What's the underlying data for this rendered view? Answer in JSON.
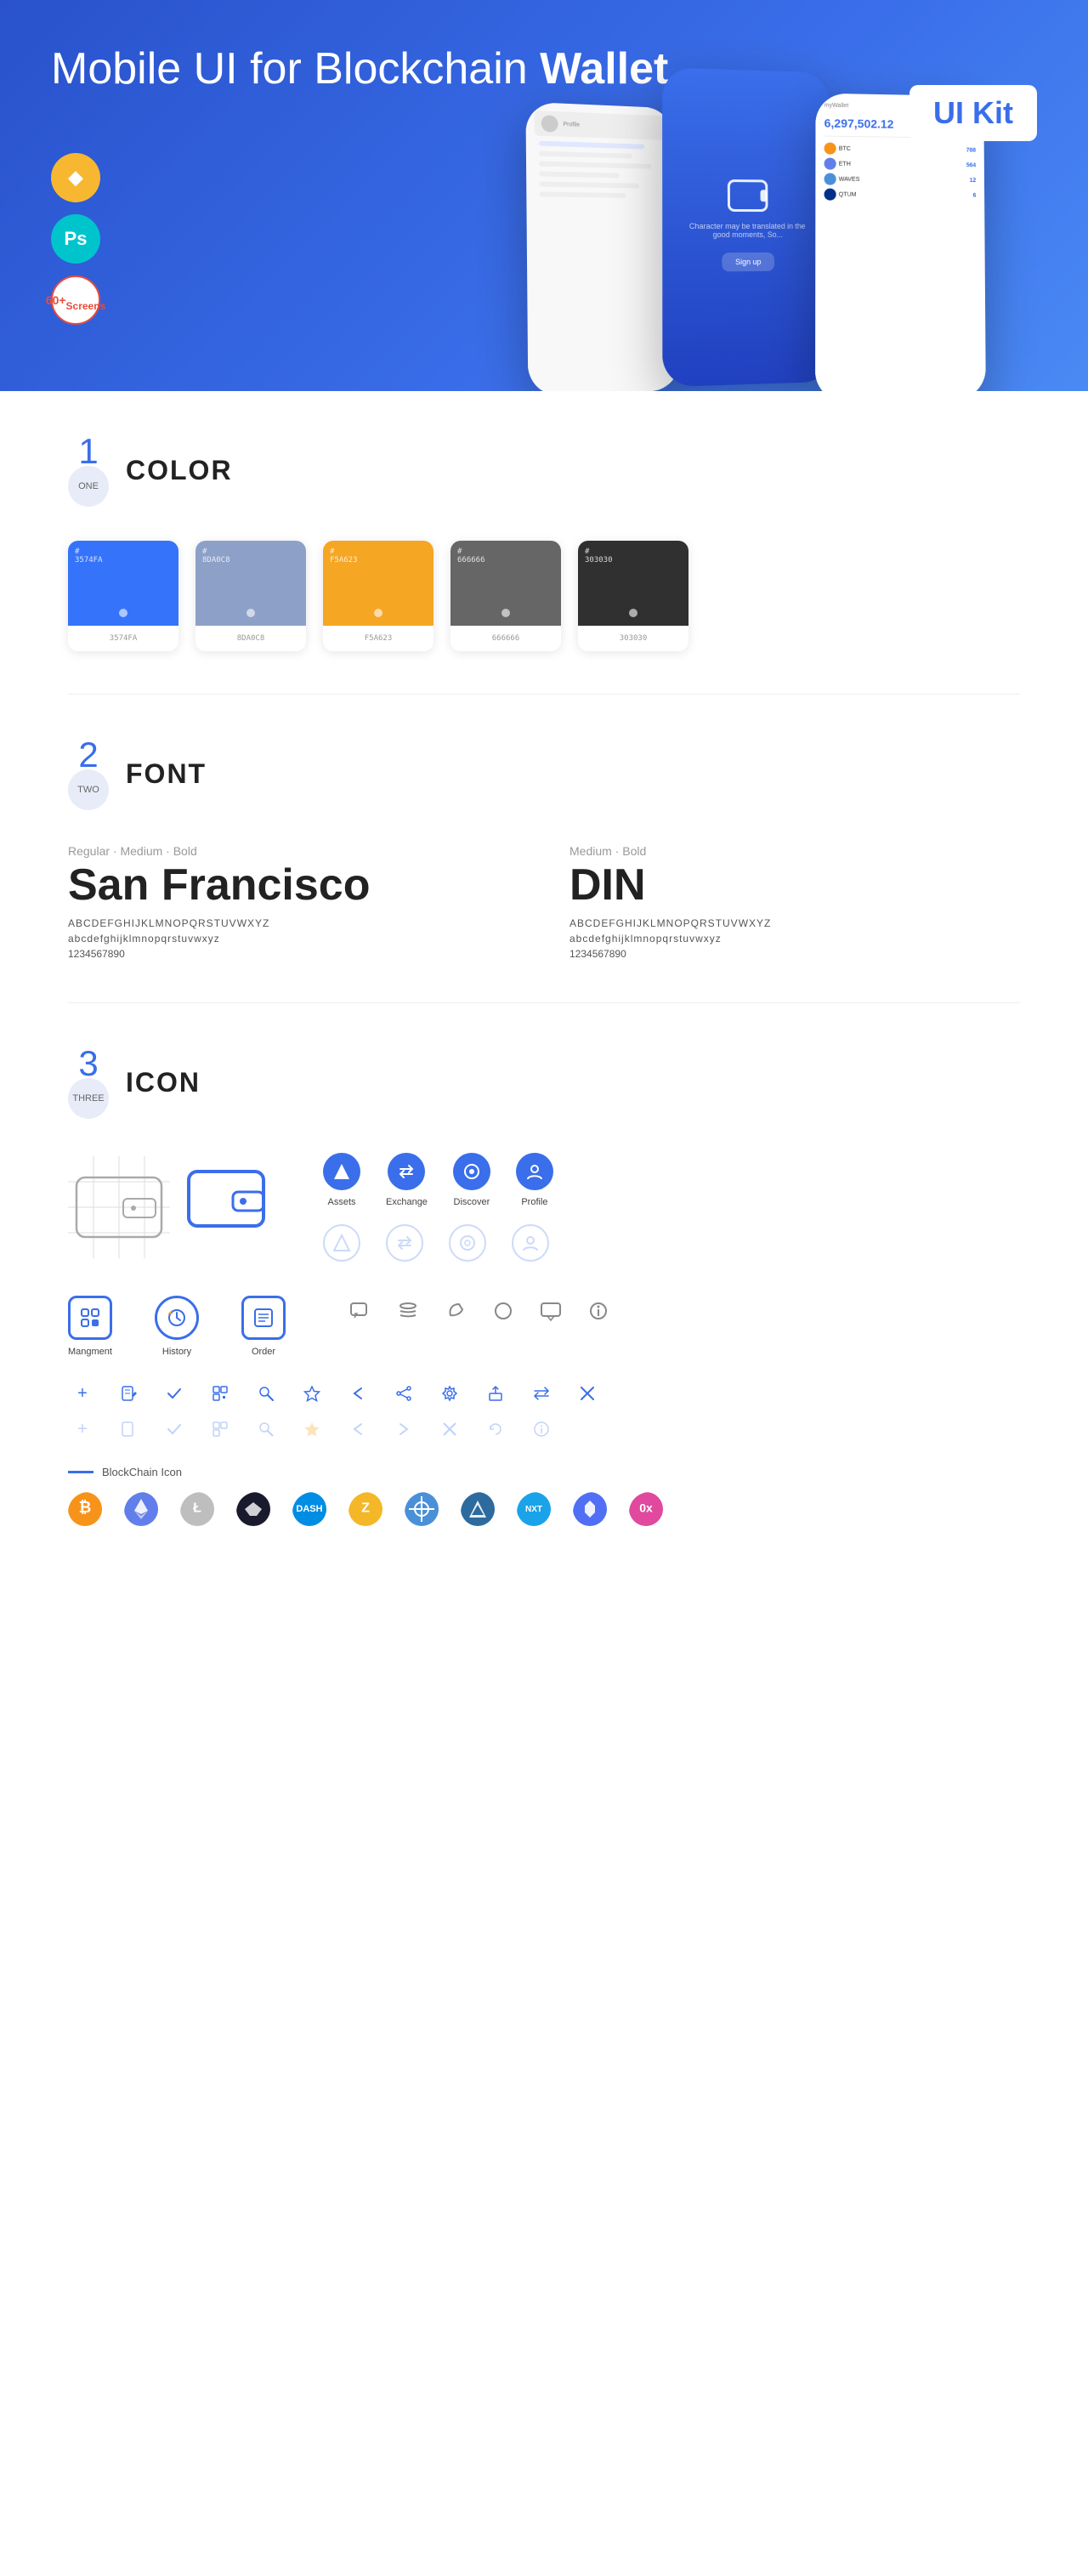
{
  "hero": {
    "title_plain": "Mobile UI for Blockchain ",
    "title_bold": "Wallet",
    "badge": "UI Kit",
    "badge_sketch": "◆",
    "badge_ps": "Ps",
    "badge_screens_line1": "60+",
    "badge_screens_line2": "Screens"
  },
  "section1": {
    "num": "1",
    "num_label": "ONE",
    "title": "COLOR",
    "swatches": [
      {
        "hex": "#3574FA",
        "hex_label": "#\n3574FA",
        "color": "#3574FA"
      },
      {
        "hex": "#8DA0C8",
        "hex_label": "#\n8DA0C8",
        "color": "#8DA0C8"
      },
      {
        "hex": "#F5A623",
        "hex_label": "#\nF5A623",
        "color": "#F5A623"
      },
      {
        "hex": "#666666",
        "hex_label": "#\n666666",
        "color": "#666666"
      },
      {
        "hex": "#303030",
        "hex_label": "#\n303030",
        "color": "#303030"
      }
    ]
  },
  "section2": {
    "num": "2",
    "num_label": "TWO",
    "title": "FONT",
    "fonts": [
      {
        "style_label": "Regular · Medium · Bold",
        "name": "San Francisco",
        "uppercase": "ABCDEFGHIJKLMNOPQRSTUVWXYZ",
        "lowercase": "abcdefghijklmnopqrstuvwxyz",
        "numbers": "1234567890"
      },
      {
        "style_label": "Medium · Bold",
        "name": "DIN",
        "uppercase": "ABCDEFGHIJKLMNOPQRSTUVWXYZ",
        "lowercase": "abcdefghijklmnopqrstuvwxyz",
        "numbers": "1234567890"
      }
    ]
  },
  "section3": {
    "num": "3",
    "num_label": "THREE",
    "title": "ICON",
    "nav_icons": [
      {
        "label": "Assets"
      },
      {
        "label": "Exchange"
      },
      {
        "label": "Discover"
      },
      {
        "label": "Profile"
      }
    ],
    "app_icons": [
      {
        "label": "Mangment"
      },
      {
        "label": "History"
      },
      {
        "label": "Order"
      }
    ],
    "blockchain_label": "BlockChain Icon",
    "crypto_coins": [
      {
        "name": "BTC",
        "color": "#f7931a"
      },
      {
        "name": "ETH",
        "color": "#627eea"
      },
      {
        "name": "LTC",
        "color": "#bebebe"
      },
      {
        "name": "WINGS",
        "color": "#1a1a2e"
      },
      {
        "name": "DASH",
        "color": "#008de4"
      },
      {
        "name": "ZEC",
        "color": "#f4b728"
      },
      {
        "name": "NET",
        "color": "#4a90d9"
      },
      {
        "name": "ARDR",
        "color": "#2d6b9f"
      },
      {
        "name": "NXT",
        "color": "#1aa3e8"
      },
      {
        "name": "BAND",
        "color": "#516ff5"
      },
      {
        "name": "ZRX",
        "color": "#e0499e"
      }
    ]
  }
}
